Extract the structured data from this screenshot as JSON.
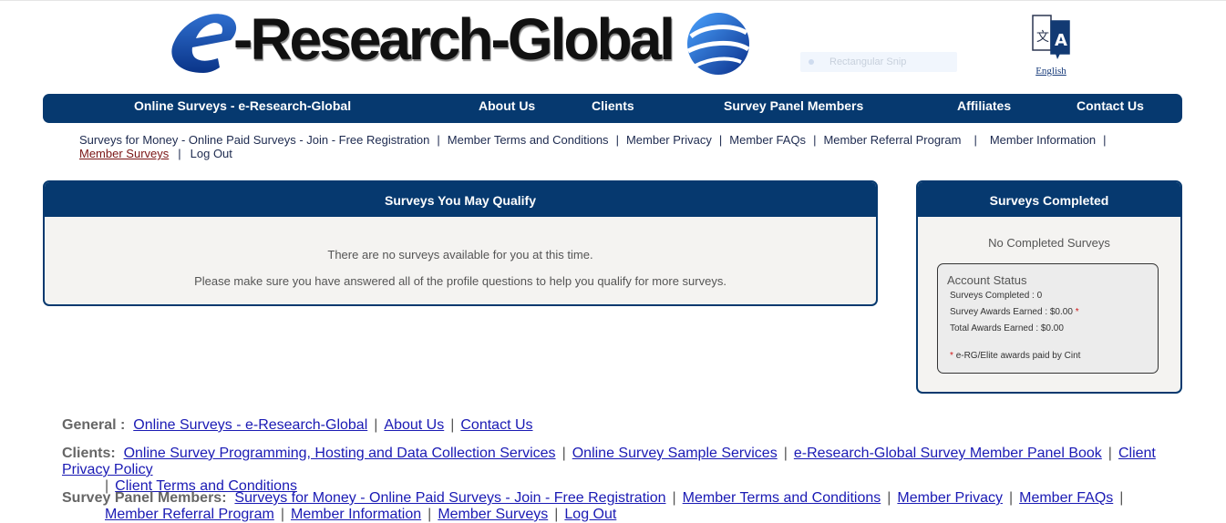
{
  "brand": {
    "logo_text": "-Research-Global"
  },
  "snip": {
    "label": "Rectangular Snip"
  },
  "language": {
    "label": "English"
  },
  "nav": {
    "home": "Online Surveys - e-Research-Global",
    "about": "About Us",
    "clients": "Clients",
    "panel": "Survey Panel Members",
    "affiliates": "Affiliates",
    "contact": "Contact Us"
  },
  "sublinks": {
    "items": [
      "Surveys for Money - Online Paid Surveys - Join - Free Registration",
      "Member Terms and Conditions",
      "Member Privacy",
      "Member FAQs",
      "Member Referral Program",
      "Member Information",
      "Member Surveys",
      "Log Out"
    ],
    "active_index": 6
  },
  "qualify_panel": {
    "title": "Surveys You May Qualify",
    "message1": "There are no surveys available for you at this time.",
    "message2": "Please make sure you have answered all of the profile questions to help you qualify for more surveys."
  },
  "completed_panel": {
    "title": "Surveys Completed",
    "message": "No Completed Surveys",
    "status": {
      "title": "Account Status",
      "completed": "Surveys Completed : 0",
      "awards_earned": "Survey Awards Earned : $0.00",
      "asterisk": "*",
      "total_awards": "Total Awards Earned : $0.00",
      "note": "e-RG/Elite awards paid by Cint"
    }
  },
  "footer": {
    "general_label": "General :",
    "general_links": [
      "Online Surveys - e-Research-Global",
      "About Us",
      "Contact Us"
    ],
    "clients_label": "Clients:",
    "clients_links": [
      "Online Survey Programming, Hosting and Data Collection Services",
      "Online Survey Sample Services",
      "e-Research-Global Survey Member Panel Book",
      "Client Privacy Policy",
      "Client Terms and Conditions"
    ],
    "panel_label": "Survey Panel Members:",
    "panel_links": [
      "Surveys for Money - Online Paid Surveys - Join - Free Registration",
      "Member Terms and Conditions",
      "Member Privacy",
      "Member FAQs",
      "Member Referral Program",
      "Member Information",
      "Member Surveys",
      "Log Out"
    ]
  },
  "colors": {
    "nav_bg": "#06396f",
    "link": "#1a1ab4",
    "active_link": "#7a1515",
    "asterisk": "#d01818"
  }
}
